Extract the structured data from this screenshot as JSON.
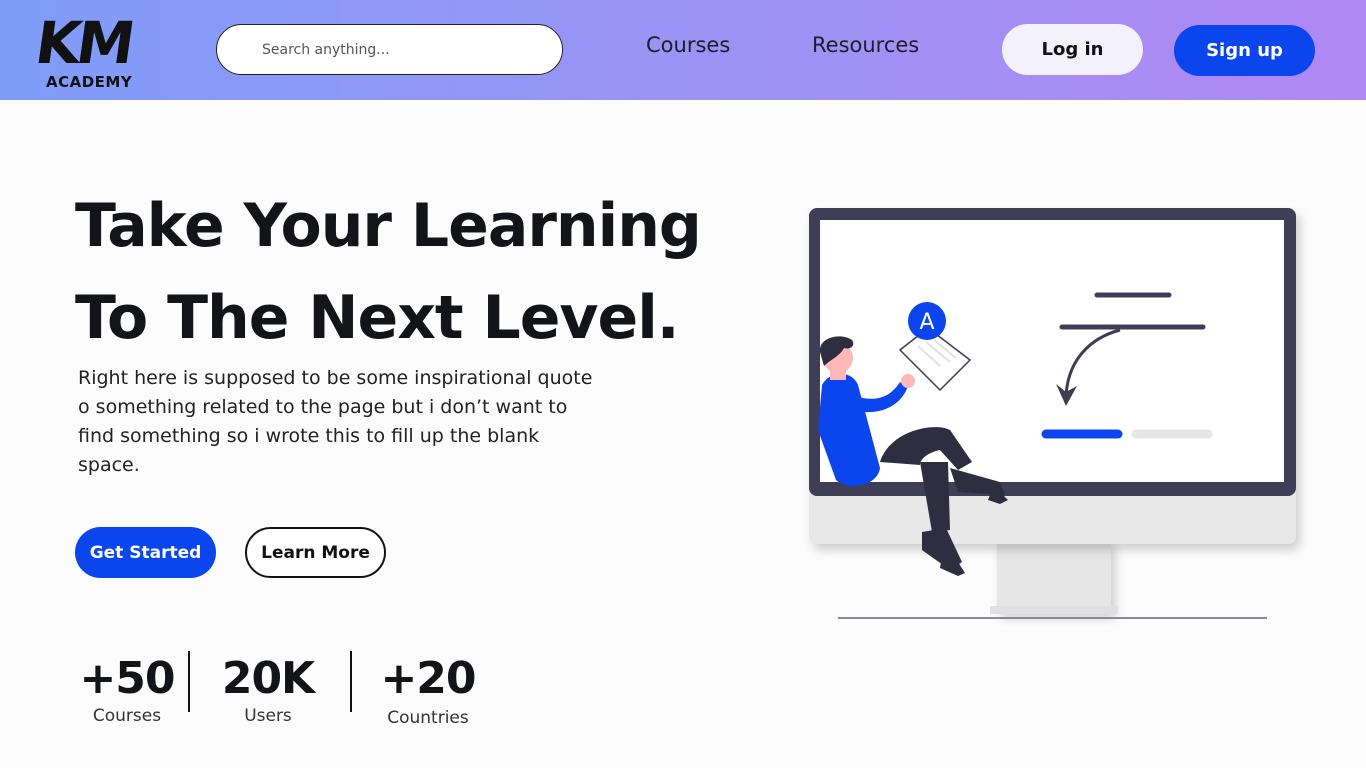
{
  "brand": {
    "mark": "KM",
    "name": "ACADEMY"
  },
  "search": {
    "placeholder": "Search anything..."
  },
  "nav": {
    "courses": "Courses",
    "resources": "Resources"
  },
  "auth": {
    "login": "Log in",
    "signup": "Sign up"
  },
  "hero": {
    "title_line1": "Take Your Learning",
    "title_line2": "To The Next Level.",
    "description": "Right here is supposed to be some inspirational quote o something related to the page but i don’t want to find something so i wrote this to fill up the blank space.",
    "primary_cta": "Get Started",
    "secondary_cta": "Learn More"
  },
  "stats": [
    {
      "value": "+50",
      "label": "Courses"
    },
    {
      "value": "20K",
      "label": "Users"
    },
    {
      "value": "+20",
      "label": "Countries"
    }
  ],
  "illustration": {
    "badge_letter": "A"
  },
  "colors": {
    "accent": "#0a45ee",
    "header_start": "#7f9cf9",
    "header_end": "#b088f4",
    "text": "#121417"
  }
}
